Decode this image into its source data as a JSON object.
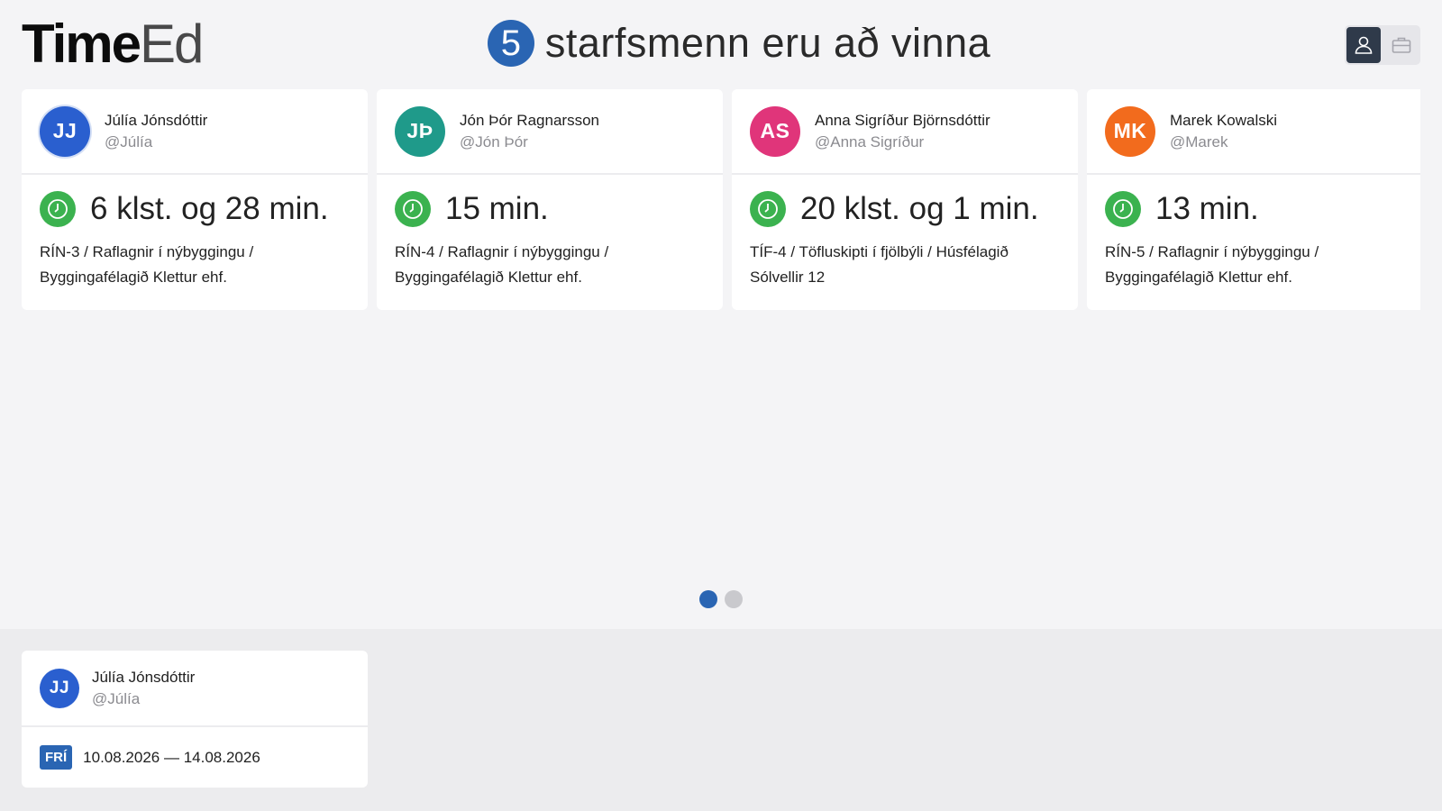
{
  "header": {
    "logo_bold": "Time",
    "logo_light": "Ed",
    "active_count": "5",
    "headline": "starfsmenn eru að vinna"
  },
  "view_toggle": {
    "options": [
      {
        "icon": "person-icon",
        "active": true
      },
      {
        "icon": "briefcase-icon",
        "active": false
      }
    ]
  },
  "working": [
    {
      "initials": "JJ",
      "avatar_color": "#2a5fcf",
      "name": "Júlía Jónsdóttir",
      "handle": "@Júlía",
      "duration": "6 klst. og 28 min.",
      "task_line1": "RÍN-3 / Raflagnir í nýbyggingu /",
      "task_line2": "Byggingafélagið Klettur ehf."
    },
    {
      "initials": "JÞ",
      "avatar_color": "#1f9a8a",
      "name": "Jón Þór Ragnarsson",
      "handle": "@Jón Þór",
      "duration": "15 min.",
      "task_line1": "RÍN-4 / Raflagnir í nýbyggingu /",
      "task_line2": "Byggingafélagið Klettur ehf."
    },
    {
      "initials": "AS",
      "avatar_color": "#e0357a",
      "name": "Anna Sigríður Björnsdóttir",
      "handle": "@Anna Sigríður",
      "duration": "20 klst. og 1 min.",
      "task_line1": "TÍF-4 / Töfluskipti í fjölbýli / Húsfélagið",
      "task_line2": "Sólvellir 12"
    },
    {
      "initials": "MK",
      "avatar_color": "#f26b1d",
      "name": "Marek Kowalski",
      "handle": "@Marek",
      "duration": "13 min.",
      "task_line1": "RÍN-5 / Raflagnir í nýbyggingu /",
      "task_line2": "Byggingafélagið Klettur ehf."
    }
  ],
  "pagination": {
    "pages": 2,
    "current": 1
  },
  "leave": [
    {
      "initials": "JJ",
      "avatar_color": "#2a5fcf",
      "name": "Júlía Jónsdóttir",
      "handle": "@Júlía",
      "badge": "FRÍ",
      "dates": "10.08.2026 — 14.08.2026"
    }
  ],
  "colors": {
    "accent": "#2a65b3",
    "clock_green": "#3bb24f"
  }
}
